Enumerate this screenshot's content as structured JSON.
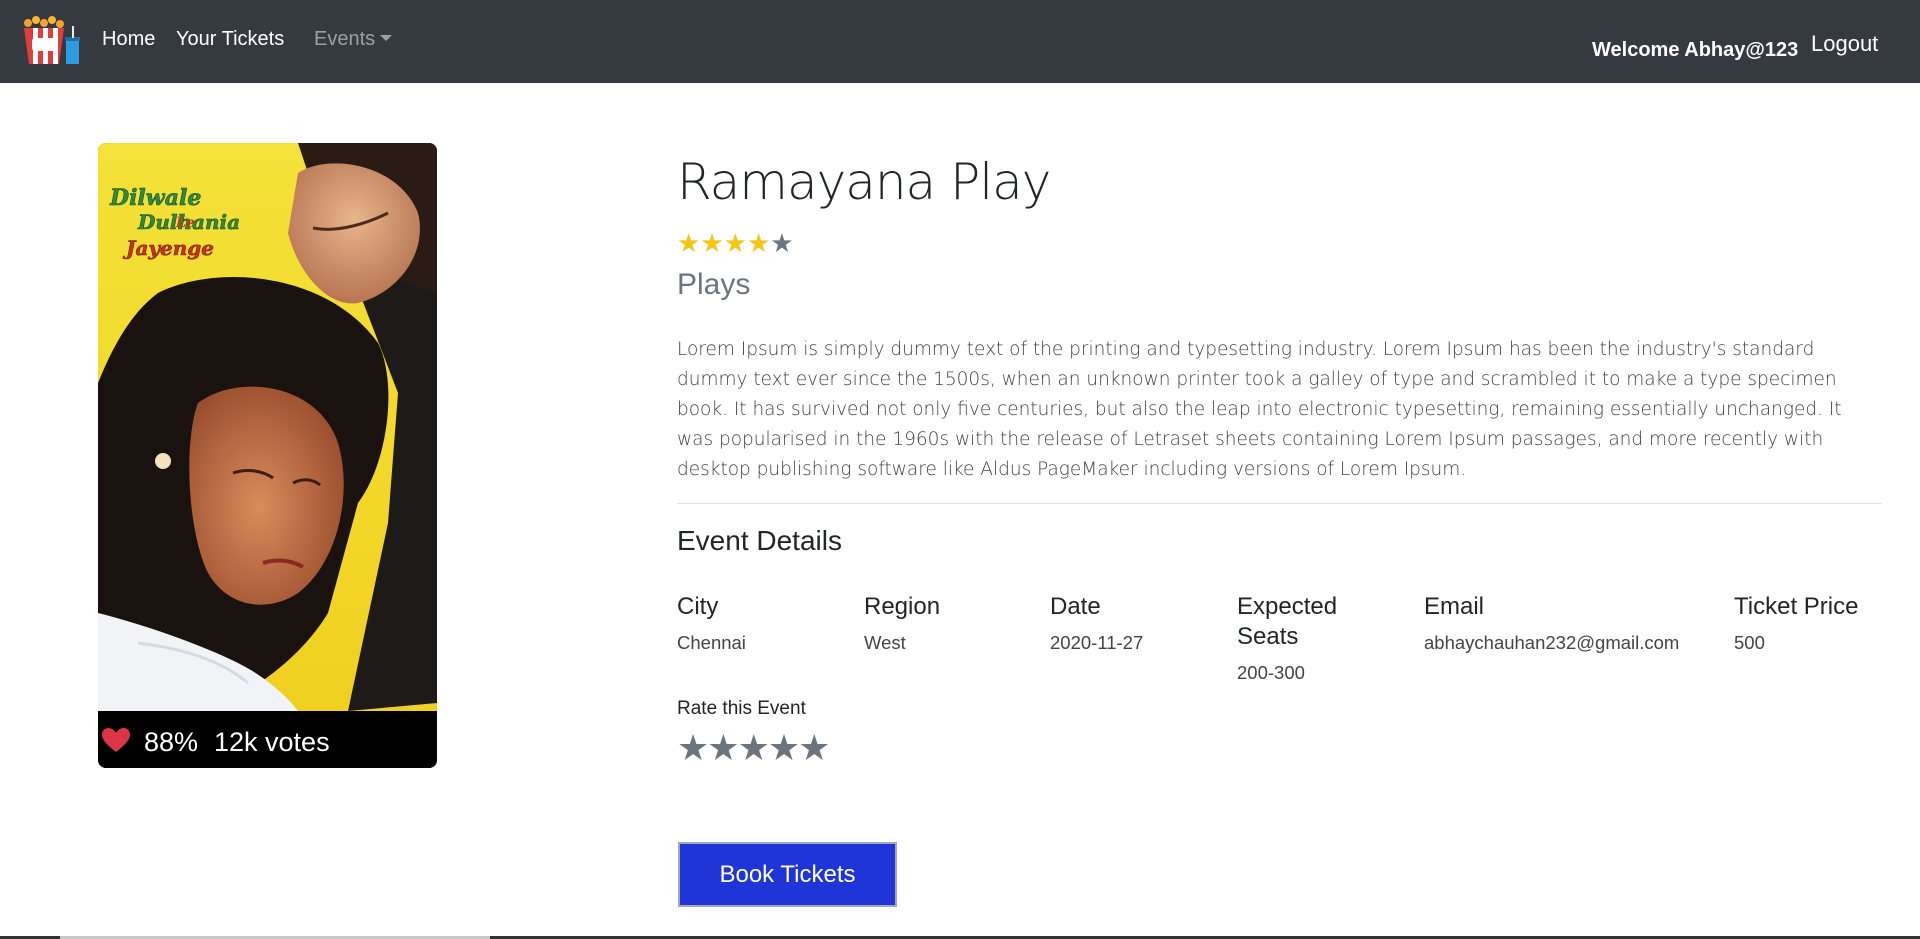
{
  "nav": {
    "logo": "popcorn-logo-icon",
    "home": "Home",
    "your_tickets": "Your Tickets",
    "events": "Events",
    "welcome": "Welcome Abhay@123",
    "logout": "Logout"
  },
  "poster": {
    "poster_text": "Dilwale Dulhania Le Jayenge",
    "rating_percent": "88%",
    "votes": "12k votes",
    "heart_color": "#dc3545"
  },
  "event": {
    "title": "Ramayana Play",
    "rating": 4,
    "rating_max": 5,
    "category": "Plays",
    "description": "Lorem Ipsum is simply dummy text of the printing and typesetting industry. Lorem Ipsum has been the industry's standard dummy text ever since the 1500s, when an unknown printer took a galley of type and scrambled it to make a type specimen book. It has survived not only five centuries, but also the leap into electronic typesetting, remaining essentially unchanged. It was popularised in the 1960s with the release of Letraset sheets containing Lorem Ipsum passages, and more recently with desktop publishing software like Aldus PageMaker including versions of Lorem Ipsum."
  },
  "details": {
    "heading": "Event Details",
    "city_label": "City",
    "city": "Chennai",
    "region_label": "Region",
    "region": "West",
    "date_label": "Date",
    "date": "2020-11-27",
    "seats_label": "Expected Seats",
    "seats": "200-300",
    "email_label": "Email",
    "email": "abhaychauhan232@gmail.com",
    "price_label": "Ticket Price",
    "price": "500"
  },
  "rate": {
    "label": "Rate this Event",
    "value": 0,
    "max": 5
  },
  "actions": {
    "book": "Book Tickets",
    "book_color": "#1f35d8"
  }
}
